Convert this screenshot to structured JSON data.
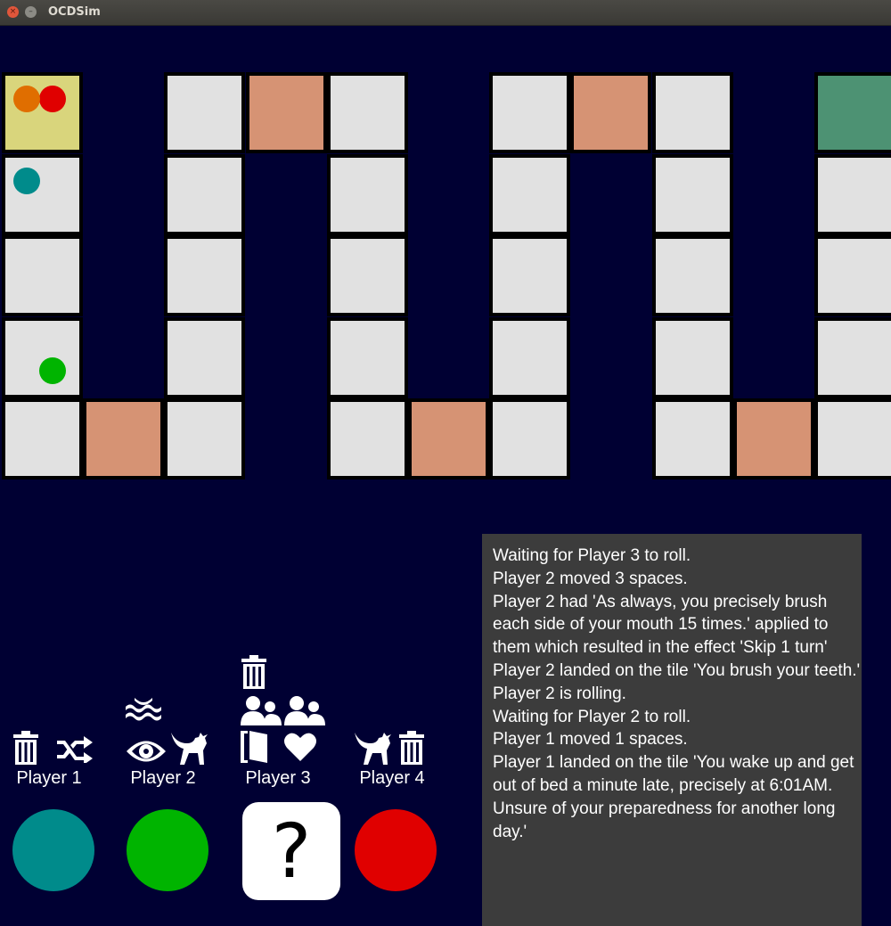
{
  "window": {
    "title": "OCDSim",
    "close_symbol": "×",
    "min_symbol": "–"
  },
  "board": {
    "colors": {
      "normal": "#e1e1e1",
      "event": "#d69374",
      "start": "#d9d57c",
      "finish": "#4d9273",
      "background": "#000033"
    },
    "tiles": [
      {
        "col": 0,
        "row": 0,
        "type": "start"
      },
      {
        "col": 0,
        "row": 1,
        "type": "normal"
      },
      {
        "col": 0,
        "row": 2,
        "type": "normal"
      },
      {
        "col": 0,
        "row": 3,
        "type": "normal"
      },
      {
        "col": 0,
        "row": 4,
        "type": "normal"
      },
      {
        "col": 1,
        "row": 4,
        "type": "event"
      },
      {
        "col": 2,
        "row": 4,
        "type": "normal"
      },
      {
        "col": 2,
        "row": 3,
        "type": "normal"
      },
      {
        "col": 2,
        "row": 2,
        "type": "normal"
      },
      {
        "col": 2,
        "row": 1,
        "type": "normal"
      },
      {
        "col": 2,
        "row": 0,
        "type": "normal"
      },
      {
        "col": 3,
        "row": 0,
        "type": "event"
      },
      {
        "col": 4,
        "row": 0,
        "type": "normal"
      },
      {
        "col": 4,
        "row": 1,
        "type": "normal"
      },
      {
        "col": 4,
        "row": 2,
        "type": "normal"
      },
      {
        "col": 4,
        "row": 3,
        "type": "normal"
      },
      {
        "col": 4,
        "row": 4,
        "type": "normal"
      },
      {
        "col": 5,
        "row": 4,
        "type": "event"
      },
      {
        "col": 6,
        "row": 4,
        "type": "normal"
      },
      {
        "col": 6,
        "row": 3,
        "type": "normal"
      },
      {
        "col": 6,
        "row": 2,
        "type": "normal"
      },
      {
        "col": 6,
        "row": 1,
        "type": "normal"
      },
      {
        "col": 6,
        "row": 0,
        "type": "normal"
      },
      {
        "col": 7,
        "row": 0,
        "type": "event"
      },
      {
        "col": 8,
        "row": 0,
        "type": "normal"
      },
      {
        "col": 8,
        "row": 1,
        "type": "normal"
      },
      {
        "col": 8,
        "row": 2,
        "type": "normal"
      },
      {
        "col": 8,
        "row": 3,
        "type": "normal"
      },
      {
        "col": 8,
        "row": 4,
        "type": "normal"
      },
      {
        "col": 9,
        "row": 4,
        "type": "event"
      },
      {
        "col": 10,
        "row": 4,
        "type": "normal"
      },
      {
        "col": 10,
        "row": 3,
        "type": "normal"
      },
      {
        "col": 10,
        "row": 2,
        "type": "normal"
      },
      {
        "col": 10,
        "row": 1,
        "type": "normal"
      },
      {
        "col": 10,
        "row": 0,
        "type": "finish"
      }
    ]
  },
  "tokens": [
    {
      "player": "Player 4",
      "color": "#e00000",
      "col": 0,
      "row": 0,
      "slot": "top-right"
    },
    {
      "player": "Player 3",
      "color": "#e06e00",
      "col": 0,
      "row": 0,
      "slot": "top-left"
    },
    {
      "player": "Player 1",
      "color": "#008b8b",
      "col": 0,
      "row": 1,
      "slot": "top-left"
    },
    {
      "player": "Player 2",
      "color": "#00b400",
      "col": 0,
      "row": 3,
      "slot": "bottom-right"
    }
  ],
  "players": [
    {
      "label": "Player 1",
      "color": "#008b8b",
      "icons": [
        [
          "trash-icon",
          "shuffle-icon"
        ]
      ]
    },
    {
      "label": "Player 2",
      "color": "#00b400",
      "icons": [
        [
          "waves-icon"
        ],
        [
          "eye-icon",
          "cat-icon"
        ]
      ]
    },
    {
      "label": "Player 3",
      "color": null,
      "icons": [
        [
          "trash-icon"
        ],
        [
          "people-icon",
          "people-icon"
        ],
        [
          "door-icon",
          "heart-icon"
        ]
      ]
    },
    {
      "label": "Player 4",
      "color": "#e00000",
      "icons": [
        [
          "cat-icon",
          "trash-icon"
        ]
      ]
    }
  ],
  "current_die": {
    "symbol": "?"
  },
  "log": [
    "Waiting for Player 3 to roll.",
    "Player 2 moved 3 spaces.",
    "Player 2 had 'As always, you precisely brush each side of your mouth 15 times.' applied to them which resulted in the effect 'Skip 1 turn'",
    "Player 2 landed on the tile 'You brush your teeth.'",
    "Player 2 is rolling.",
    "Waiting for Player 2 to roll.",
    "Player 1 moved 1 spaces.",
    "Player 1 landed on the tile 'You wake up and get out of bed a minute late, precisely at 6:01AM. Unsure of your preparedness for another long day.'"
  ]
}
